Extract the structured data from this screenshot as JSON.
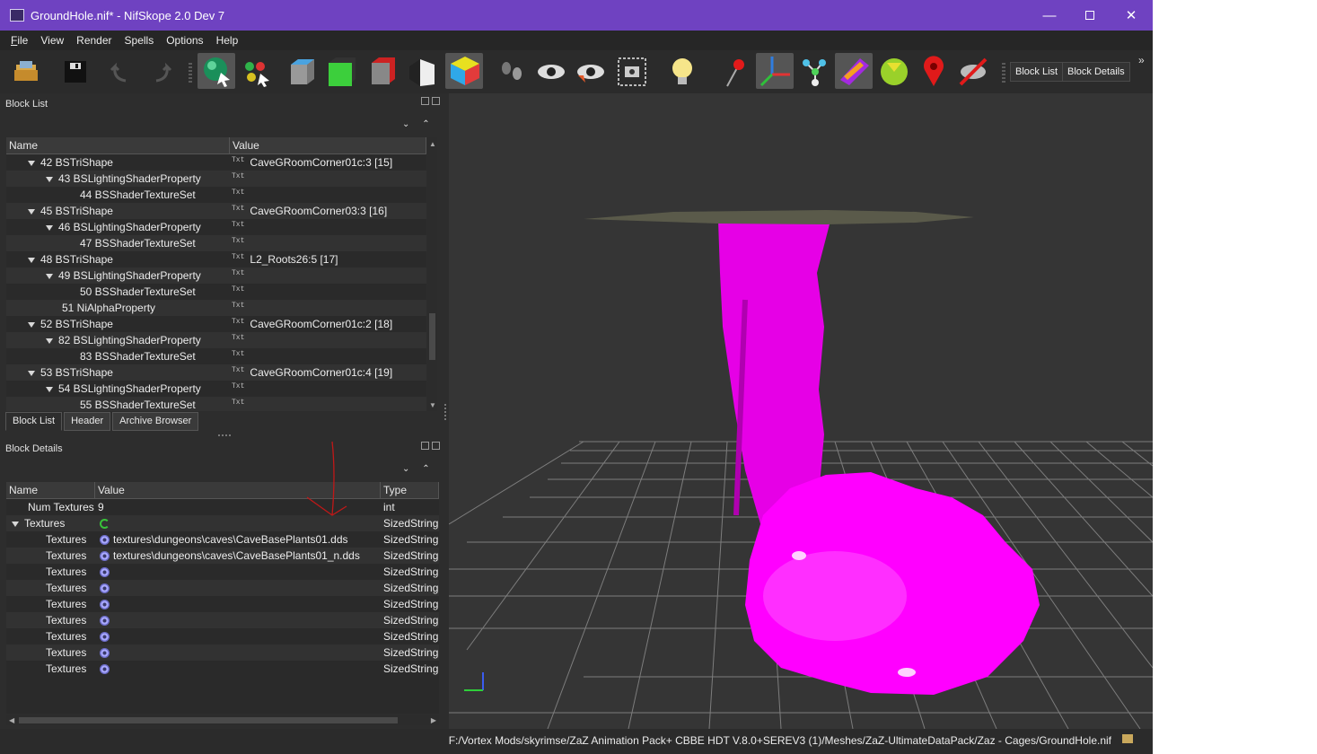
{
  "window": {
    "title": "GroundHole.nif* - NifSkope 2.0 Dev 7",
    "minimize_glyph": "—",
    "close_glyph": "✕"
  },
  "menubar": {
    "items": [
      {
        "label": "File"
      },
      {
        "label": "View"
      },
      {
        "label": "Render"
      },
      {
        "label": "Spells"
      },
      {
        "label": "Options"
      },
      {
        "label": "Help"
      }
    ]
  },
  "toolbar": {
    "block_list_label": "Block List",
    "block_details_label": "Block Details",
    "overflow_glyph": "»",
    "icons": [
      "open-icon",
      "save-icon",
      "undo-icon",
      "redo-icon",
      "select-mode-icon",
      "select-vertex-icon",
      "cube-grey-icon",
      "cube-green-icon",
      "cube-red-icon",
      "cube-bw-icon",
      "cube-color-icon",
      "footprint-icon",
      "eye-icon",
      "eye-color-icon",
      "screenshot-icon",
      "lightbulb-icon",
      "pin-icon",
      "axes-icon",
      "nodes-icon",
      "texture-icon",
      "sphere-icon",
      "marker-icon",
      "no-collision-icon"
    ]
  },
  "block_list": {
    "title": "Block List",
    "columns": {
      "name": "Name",
      "value": "Value"
    },
    "rows": [
      {
        "name": "42 BSTriShape",
        "value": "CaveGRoomCorner01c:3 [15]",
        "level": 1,
        "expanded": true
      },
      {
        "name": "43 BSLightingShaderProperty",
        "value": "",
        "level": 2,
        "expanded": true
      },
      {
        "name": "44 BSShaderTextureSet",
        "value": "",
        "level": 3,
        "expanded": false
      },
      {
        "name": "45 BSTriShape",
        "value": "CaveGRoomCorner03:3 [16]",
        "level": 1,
        "expanded": true
      },
      {
        "name": "46 BSLightingShaderProperty",
        "value": "",
        "level": 2,
        "expanded": true
      },
      {
        "name": "47 BSShaderTextureSet",
        "value": "",
        "level": 3,
        "expanded": false
      },
      {
        "name": "48 BSTriShape",
        "value": "L2_Roots26:5 [17]",
        "level": 1,
        "expanded": true
      },
      {
        "name": "49 BSLightingShaderProperty",
        "value": "",
        "level": 2,
        "expanded": true
      },
      {
        "name": "50 BSShaderTextureSet",
        "value": "",
        "level": 3,
        "expanded": false
      },
      {
        "name": "51 NiAlphaProperty",
        "value": "",
        "level": 2,
        "expanded": false
      },
      {
        "name": "52 BSTriShape",
        "value": "CaveGRoomCorner01c:2 [18]",
        "level": 1,
        "expanded": true
      },
      {
        "name": "82 BSLightingShaderProperty",
        "value": "",
        "level": 2,
        "expanded": true
      },
      {
        "name": "83 BSShaderTextureSet",
        "value": "",
        "level": 3,
        "expanded": false
      },
      {
        "name": "53 BSTriShape",
        "value": "CaveGRoomCorner01c:4 [19]",
        "level": 1,
        "expanded": true
      },
      {
        "name": "54 BSLightingShaderProperty",
        "value": "",
        "level": 2,
        "expanded": true
      },
      {
        "name": "55 BSShaderTextureSet",
        "value": "",
        "level": 3,
        "expanded": false
      }
    ],
    "txt_label": "Txt",
    "tabs": [
      {
        "label": "Block List",
        "active": true
      },
      {
        "label": "Header",
        "active": false
      },
      {
        "label": "Archive Browser",
        "active": false
      }
    ]
  },
  "block_details": {
    "title": "Block Details",
    "columns": {
      "name": "Name",
      "value": "Value",
      "type": "Type"
    },
    "rows": [
      {
        "name": "Num Textures",
        "value": "9",
        "type": "int",
        "icon": "",
        "level": 1,
        "expanded": false
      },
      {
        "name": "Textures",
        "value": "",
        "type": "SizedString",
        "icon": "refresh-icon",
        "level": 0,
        "expanded": true
      },
      {
        "name": "Textures",
        "value": "textures\\dungeons\\caves\\CaveBasePlants01.dds",
        "type": "SizedString",
        "icon": "gear-icon",
        "level": 2,
        "expanded": false
      },
      {
        "name": "Textures",
        "value": "textures\\dungeons\\caves\\CaveBasePlants01_n.dds",
        "type": "SizedString",
        "icon": "gear-icon",
        "level": 2,
        "expanded": false
      },
      {
        "name": "Textures",
        "value": "",
        "type": "SizedString",
        "icon": "gear-icon",
        "level": 2,
        "expanded": false
      },
      {
        "name": "Textures",
        "value": "",
        "type": "SizedString",
        "icon": "gear-icon",
        "level": 2,
        "expanded": false
      },
      {
        "name": "Textures",
        "value": "",
        "type": "SizedString",
        "icon": "gear-icon",
        "level": 2,
        "expanded": false
      },
      {
        "name": "Textures",
        "value": "",
        "type": "SizedString",
        "icon": "gear-icon",
        "level": 2,
        "expanded": false
      },
      {
        "name": "Textures",
        "value": "",
        "type": "SizedString",
        "icon": "gear-icon",
        "level": 2,
        "expanded": false
      },
      {
        "name": "Textures",
        "value": "",
        "type": "SizedString",
        "icon": "gear-icon",
        "level": 2,
        "expanded": false
      },
      {
        "name": "Textures",
        "value": "",
        "type": "SizedString",
        "icon": "gear-icon",
        "level": 2,
        "expanded": false
      }
    ]
  },
  "statusbar": {
    "path": "F:/Vortex Mods/skyrimse/ZaZ Animation Pack+ CBBE HDT V.8.0+SEREV3 (1)/Meshes/ZaZ-UltimateDataPack/Zaz - Cages/GroundHole.nif"
  },
  "colors": {
    "title_bar": "#6f42c1",
    "mesh_magenta": "#ff00ff",
    "viewport_bg": "#353535",
    "grid": "#8a8a8a"
  }
}
